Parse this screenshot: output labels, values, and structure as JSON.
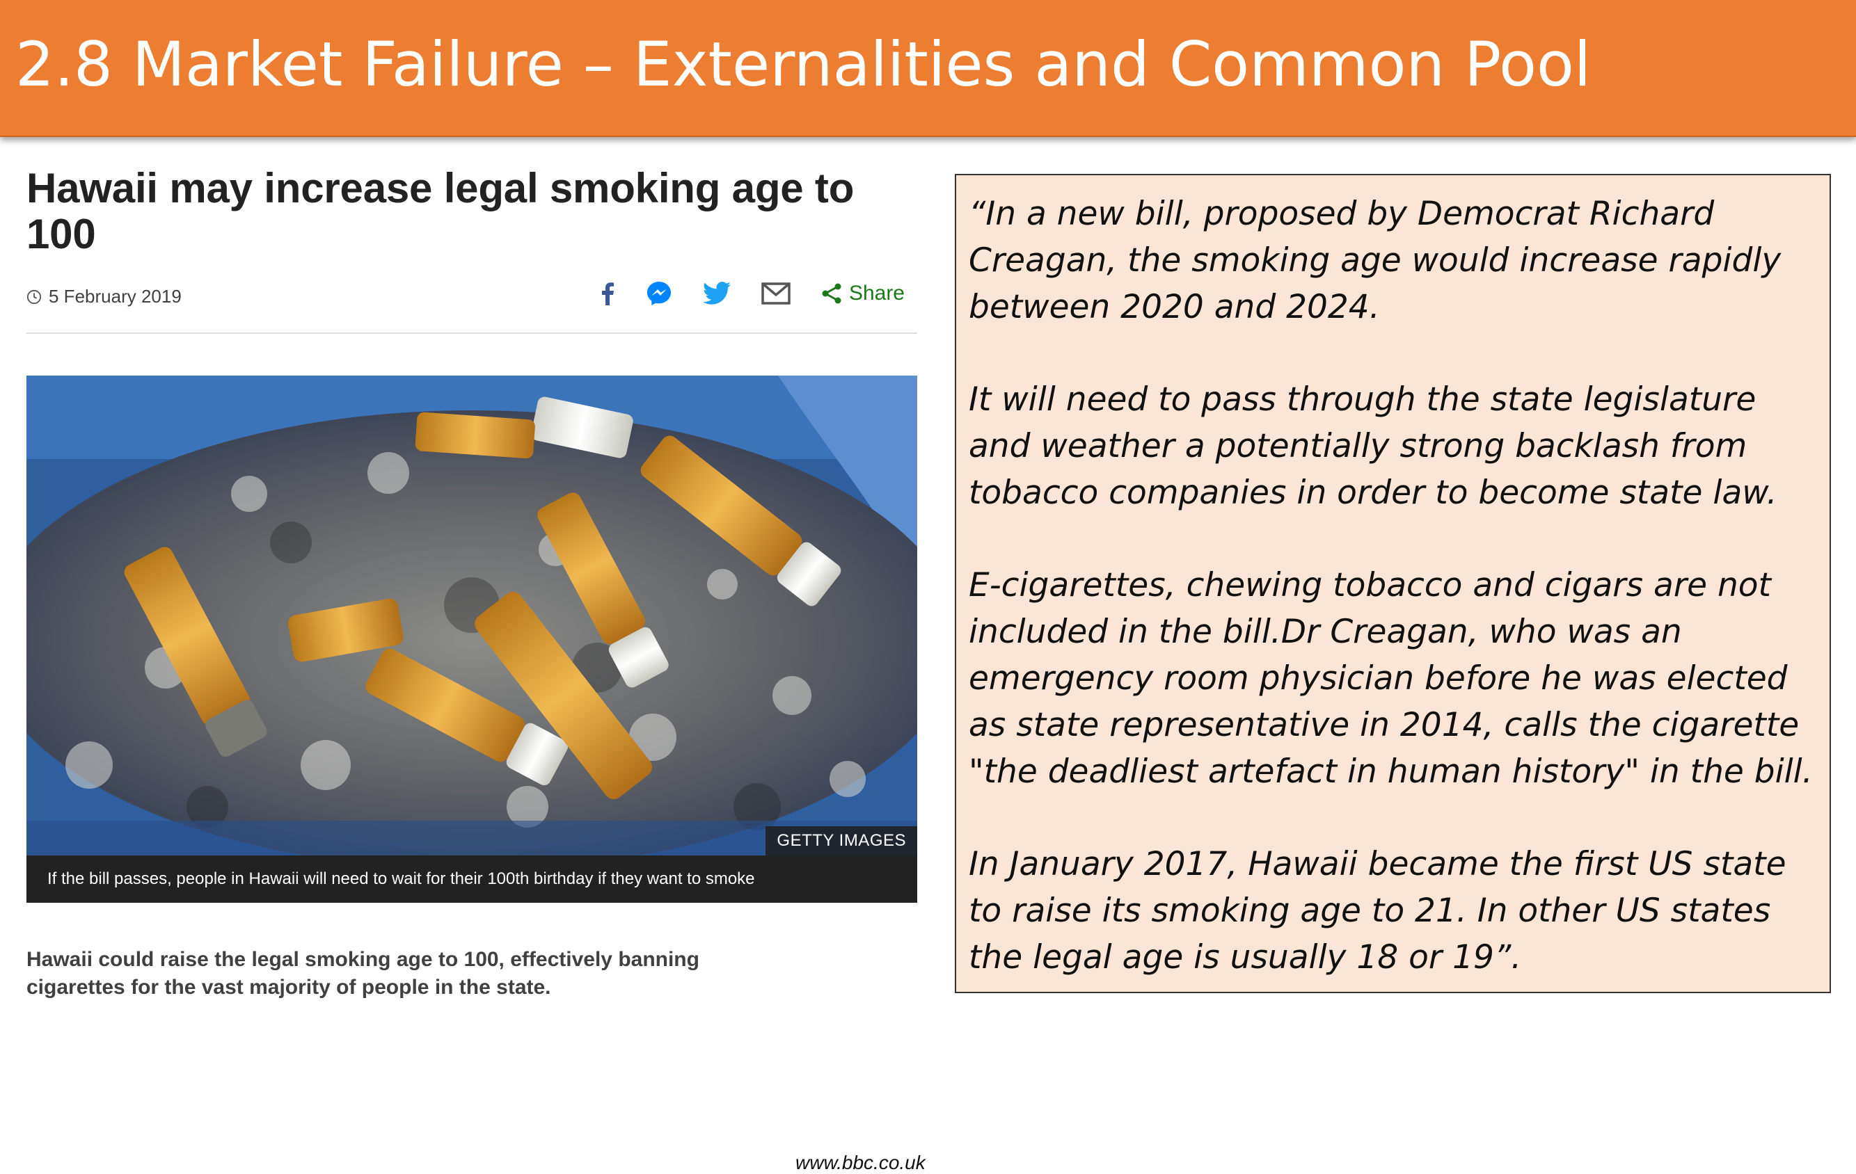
{
  "title": "2.8 Market Failure – Externalities and Common Pool",
  "article": {
    "headline": "Hawaii may increase legal smoking age to 100",
    "date": "5 February 2019",
    "share_label": "Share",
    "icons": [
      "facebook-icon",
      "messenger-icon",
      "twitter-icon",
      "email-icon",
      "share-icon",
      "clock-icon"
    ],
    "image_credit": "GETTY IMAGES",
    "image_caption": "If the bill passes, people in Hawaii will need to wait for their 100th birthday if they want to smoke",
    "summary": "Hawaii could raise the legal smoking age to 100, effectively banning cigarettes for the vast majority of people in the state.",
    "source": "www.bbc.co.uk"
  },
  "quote": {
    "paragraphs": [
      "“In a new bill, proposed by Democrat Richard Creagan, the smoking age would increase rapidly between 2020 and 2024.",
      "It will need to pass through the state legislature and weather a potentially strong backlash from tobacco companies in order to become state law.",
      "E-cigarettes, chewing tobacco and cigars are not included in the bill.Dr Creagan, who was an emergency room physician before he was elected as state representative in 2014, calls the cigarette \"the deadliest artefact in human history\" in the bill.",
      "In January 2017, Hawaii became the first US state to raise its smoking age to 21. In other US states the legal age is usually 18 or 19”."
    ]
  },
  "colors": {
    "title_bar": "#ed7d31",
    "quote_background": "#fbe5d6",
    "share_green": "#1a7a1a",
    "caption_bar": "#222222"
  }
}
